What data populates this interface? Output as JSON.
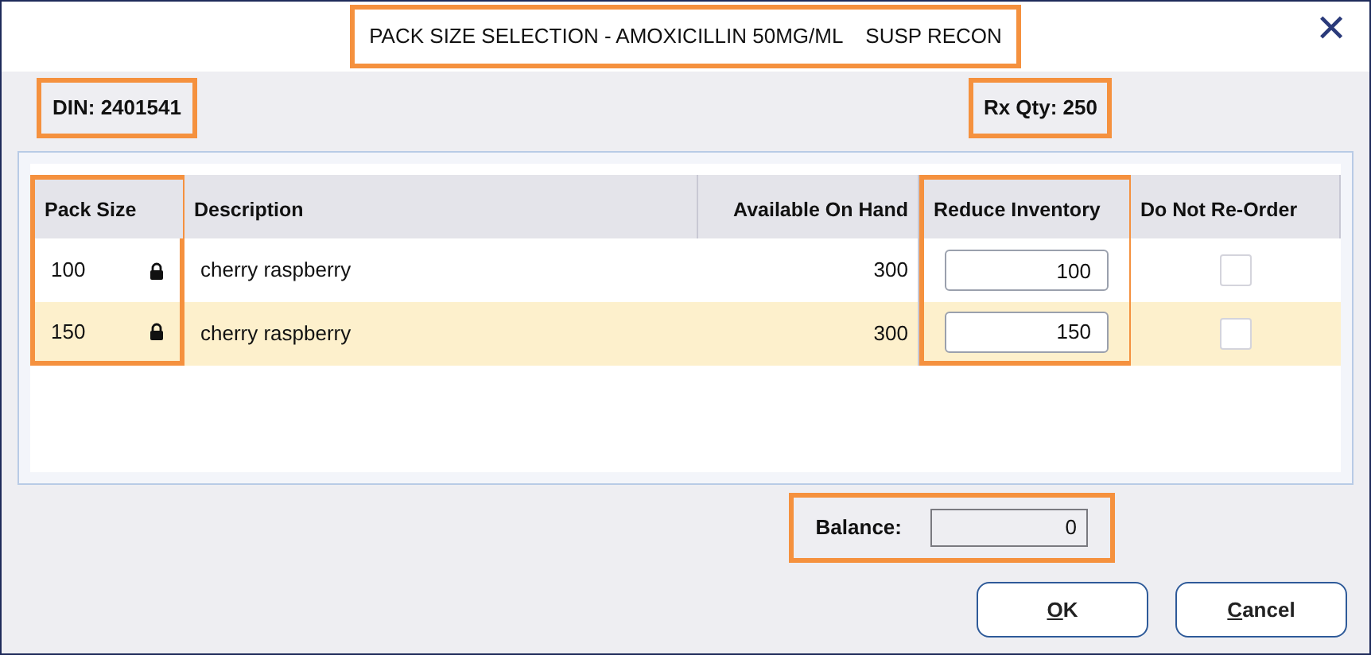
{
  "window": {
    "title": "PACK SIZE SELECTION - AMOXICILLIN 50MG/ML    SUSP RECON",
    "title_highlighted": true,
    "close": "✕"
  },
  "din": {
    "text": "DIN: 2401541",
    "highlighted": true
  },
  "rx_qty": {
    "text": "Rx Qty: 250",
    "highlighted": true
  },
  "table": {
    "columns": [
      {
        "label": "Pack Size",
        "highlighted": true
      },
      {
        "label": "Description",
        "highlighted": false
      },
      {
        "label": "Available On Hand",
        "highlighted": false
      },
      {
        "label": "Reduce Inventory",
        "highlighted": true
      },
      {
        "label": "Do Not Re-Order",
        "highlighted": false
      }
    ],
    "rows": [
      {
        "pack_size": "100",
        "locked": true,
        "description": "cherry raspberry",
        "available": "300",
        "reduce": "100",
        "do_not_reorder": false,
        "selected": false
      },
      {
        "pack_size": "150",
        "locked": true,
        "description": "cherry raspberry",
        "available": "300",
        "reduce": "150",
        "do_not_reorder": false,
        "selected": true
      }
    ]
  },
  "balance": {
    "label": "Balance:",
    "value": "0",
    "highlighted": true
  },
  "buttons": [
    {
      "mnemonic": "O",
      "rest": "K"
    },
    {
      "mnemonic": "C",
      "rest": "ancel"
    }
  ]
}
